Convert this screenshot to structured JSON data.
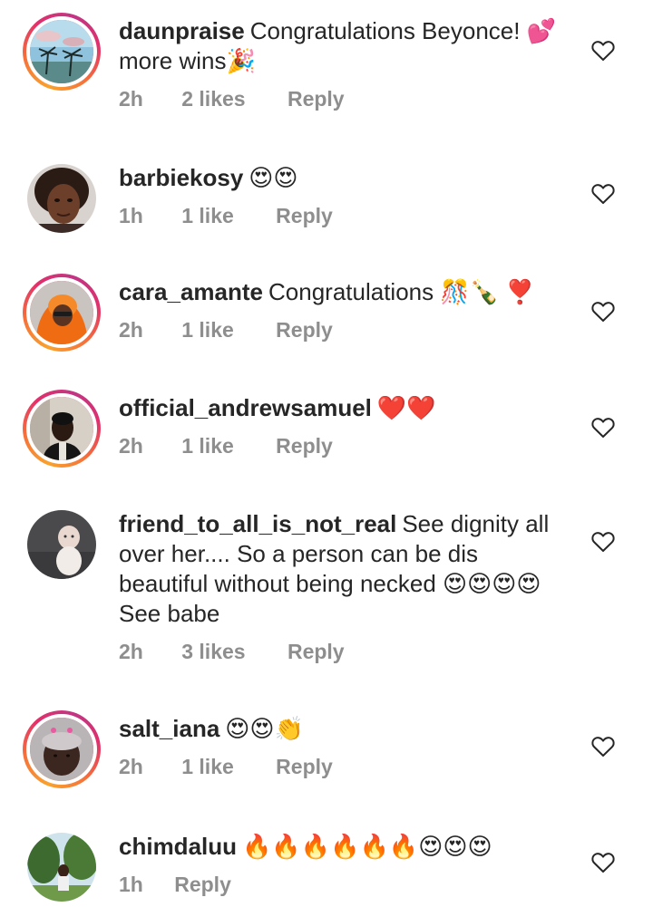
{
  "comments": [
    {
      "username": "daunpraise",
      "text": "Congratulations Beyonce! 💕more wins🎉",
      "time": "2h",
      "likes": "2 likes",
      "reply": "Reply"
    },
    {
      "username": "barbiekosy",
      "text": "😍😍",
      "time": "1h",
      "likes": "1 like",
      "reply": "Reply"
    },
    {
      "username": "cara_amante",
      "text": "Congratulations 🎊🍾 ❣️",
      "time": "2h",
      "likes": "1 like",
      "reply": "Reply"
    },
    {
      "username": "official_andrewsamuel",
      "text": "❤️❤️",
      "time": "2h",
      "likes": "1 like",
      "reply": "Reply"
    },
    {
      "username": "friend_to_all_is_not_real",
      "text": "See dignity all over her.... So a person can be dis beautiful without being necked 😍😍😍😍See babe",
      "time": "2h",
      "likes": "3 likes",
      "reply": "Reply"
    },
    {
      "username": "salt_iana",
      "text": "😍😍👏",
      "time": "2h",
      "likes": "1 like",
      "reply": "Reply"
    },
    {
      "username": "chimdaluu",
      "text": "🔥🔥🔥🔥🔥🔥😍😍😍",
      "time": "1h",
      "likes": "",
      "reply": "Reply"
    }
  ],
  "icons": {
    "like": "heart-outline-icon"
  },
  "colors": {
    "text": "#262626",
    "meta": "#8e8e8e",
    "story_ring_start": "#f9a22d",
    "story_ring_end": "#c13584"
  }
}
